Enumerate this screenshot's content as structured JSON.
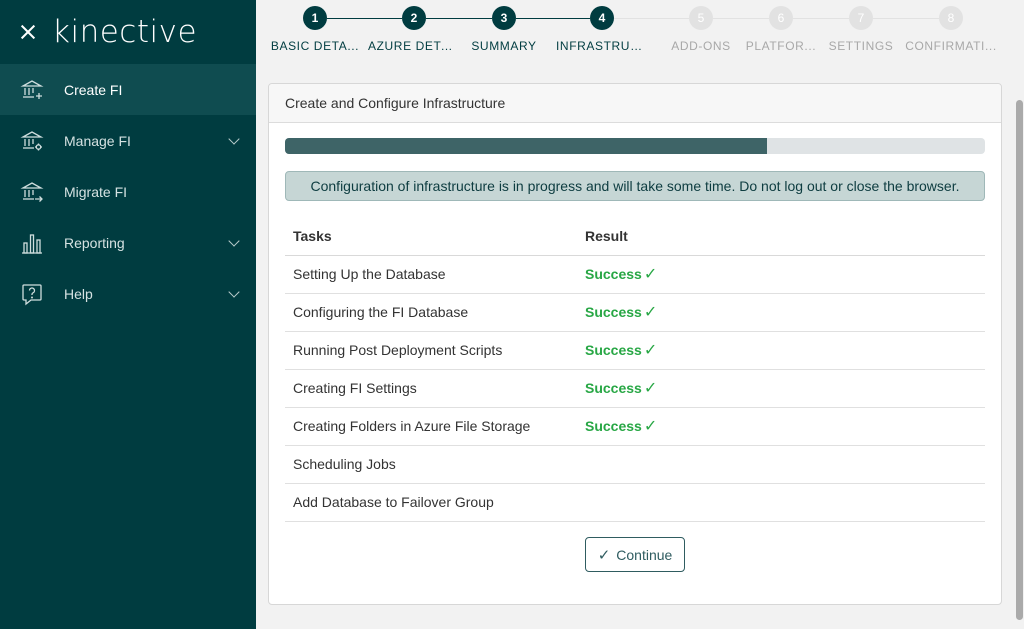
{
  "app": {
    "logo": "kinective"
  },
  "sidebar": {
    "items": [
      {
        "label": "Create FI",
        "icon": "bank-add-icon",
        "active": true,
        "expandable": false
      },
      {
        "label": "Manage FI",
        "icon": "bank-settings-icon",
        "active": false,
        "expandable": true
      },
      {
        "label": "Migrate FI",
        "icon": "bank-migrate-icon",
        "active": false,
        "expandable": false
      },
      {
        "label": "Reporting",
        "icon": "bar-chart-icon",
        "active": false,
        "expandable": true
      },
      {
        "label": "Help",
        "icon": "help-chat-icon",
        "active": false,
        "expandable": true
      }
    ]
  },
  "stepper": {
    "steps": [
      {
        "number": "1",
        "label": "BASIC DETAILS",
        "display": "BASIC DETA...",
        "state": "done"
      },
      {
        "number": "2",
        "label": "AZURE DETAILS",
        "display": "AZURE DETA...",
        "state": "done"
      },
      {
        "number": "3",
        "label": "SUMMARY",
        "display": "SUMMARY",
        "state": "done"
      },
      {
        "number": "4",
        "label": "INFRASTRUCTURE",
        "display": "INFRASTRUCT...",
        "state": "done"
      },
      {
        "number": "5",
        "label": "ADD-ONS",
        "display": "ADD-ONS",
        "state": "todo"
      },
      {
        "number": "6",
        "label": "PLATFORM",
        "display": "PLATFOR...",
        "state": "todo"
      },
      {
        "number": "7",
        "label": "SETTINGS",
        "display": "SETTINGS",
        "state": "todo"
      },
      {
        "number": "8",
        "label": "CONFIRMATION",
        "display": "CONFIRMATI...",
        "state": "todo"
      }
    ],
    "colors": {
      "done": "#003c40",
      "todo": "#e2e2e2"
    }
  },
  "card": {
    "title": "Create and Configure Infrastructure",
    "progress_fraction": 0.688,
    "alert": "Configuration of infrastructure is in progress and will take some time. Do not log out or close the browser.",
    "table": {
      "headers": {
        "task": "Tasks",
        "result": "Result"
      },
      "rows": [
        {
          "task": "Setting Up the Database",
          "result": "Success",
          "mark": "✓"
        },
        {
          "task": "Configuring the FI Database",
          "result": "Success",
          "mark": "✓"
        },
        {
          "task": "Running Post Deployment Scripts",
          "result": "Success",
          "mark": "✓"
        },
        {
          "task": "Creating FI Settings",
          "result": "Success",
          "mark": "✓"
        },
        {
          "task": "Creating Folders in Azure File Storage",
          "result": "Success",
          "mark": "✓"
        },
        {
          "task": "Scheduling Jobs",
          "result": "",
          "mark": ""
        },
        {
          "task": "Add Database to Failover Group",
          "result": "",
          "mark": ""
        }
      ]
    },
    "continue_label": "Continue",
    "continue_mark": "✓"
  },
  "colors": {
    "sidebar_bg": "#003c40",
    "accent": "#003c40",
    "success": "#28a745",
    "progress": "#3e6467"
  }
}
